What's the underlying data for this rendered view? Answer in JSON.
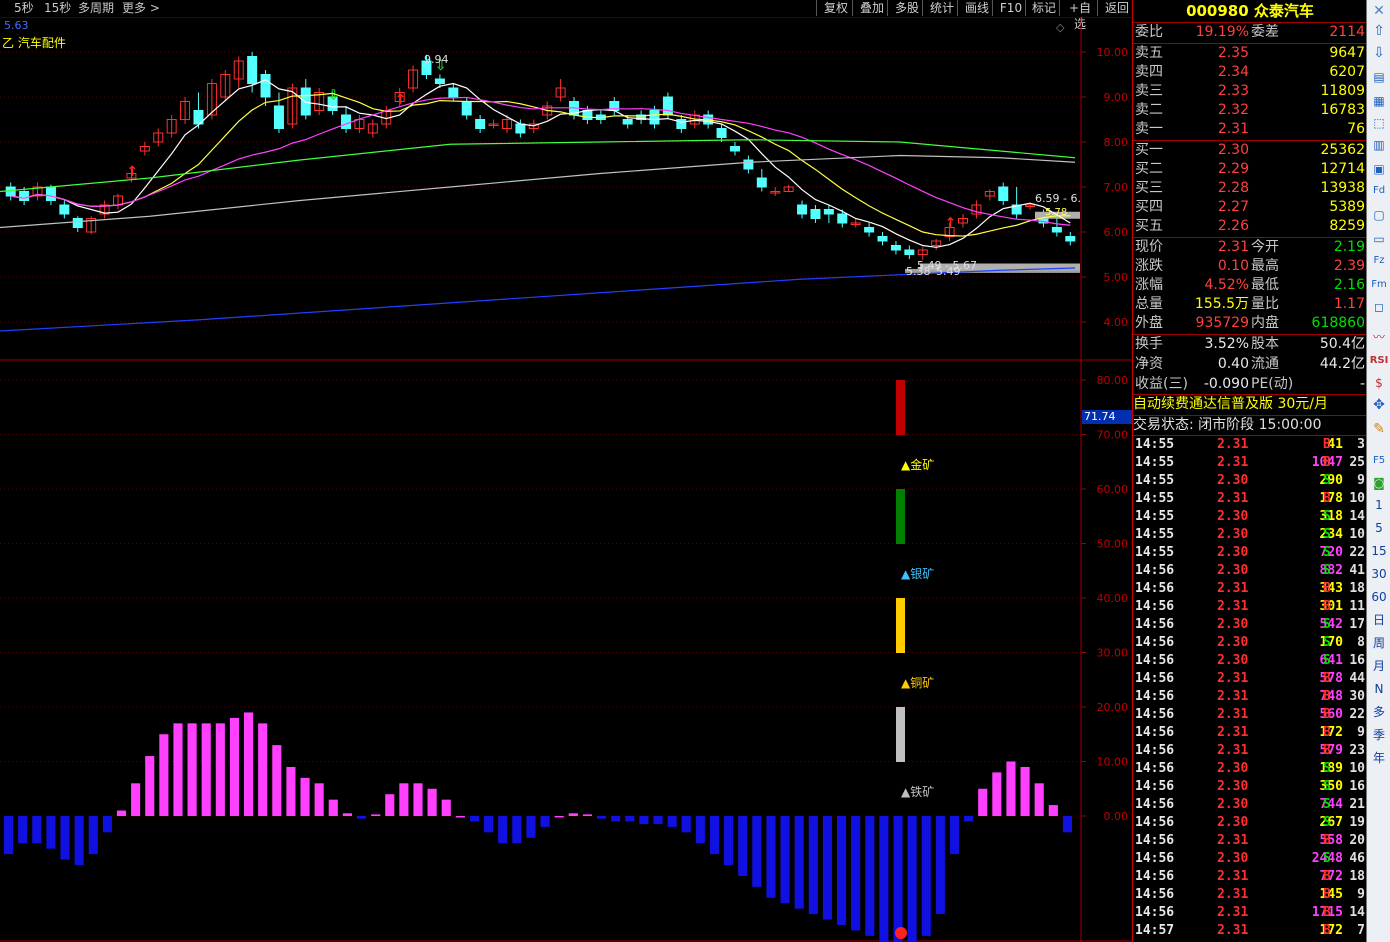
{
  "toolbar": {
    "left": [
      "5秒",
      "15秒",
      "多周期",
      "更多 >"
    ],
    "right": [
      "复权",
      "叠加",
      "多股",
      "统计",
      "画线",
      "F10",
      "标记",
      "+自选",
      "返回"
    ]
  },
  "chart": {
    "top_left_value": "5.63",
    "sector_label": "乙 汽车配件",
    "price_axis": [
      "10.00",
      "9.00",
      "8.00",
      "7.00",
      "6.00",
      "5.00",
      "4.00"
    ],
    "ind_axis": [
      "80.00",
      "70.00",
      "60.00",
      "50.00",
      "40.00",
      "30.00",
      "20.00",
      "10.00",
      "0.00"
    ],
    "current_ind_value": "71.74",
    "annotations": {
      "high": "9.94",
      "mid_right": "6.59 - 6.",
      "low": "5.49 - 5.67",
      "low2": "5.38",
      "low3": "5.49",
      "small": "5.78"
    },
    "mine_labels": [
      "▲金矿",
      "▲银矿",
      "▲铜矿",
      "▲铁矿"
    ],
    "colors": {
      "up": "#ff3030",
      "down": "#54ffff",
      "ma5": "#ffffff",
      "ma10": "#ffff40",
      "ma20": "#ff40ff",
      "ma60": "#40ff40",
      "ma120": "#c0c0c0",
      "ma250": "#2040ff"
    }
  },
  "stock": {
    "code": "000980",
    "name": "众泰汽车"
  },
  "quote": {
    "weibi_label": "委比",
    "weibi": "19.19%",
    "weicha_label": "委差",
    "weicha": "2114",
    "sell": [
      {
        "label": "卖五",
        "price": "2.35",
        "vol": "9647"
      },
      {
        "label": "卖四",
        "price": "2.34",
        "vol": "6207"
      },
      {
        "label": "卖三",
        "price": "2.33",
        "vol": "11809"
      },
      {
        "label": "卖二",
        "price": "2.32",
        "vol": "16783"
      },
      {
        "label": "卖一",
        "price": "2.31",
        "vol": "76"
      }
    ],
    "buy": [
      {
        "label": "买一",
        "price": "2.30",
        "vol": "25362"
      },
      {
        "label": "买二",
        "price": "2.29",
        "vol": "12714"
      },
      {
        "label": "买三",
        "price": "2.28",
        "vol": "13938"
      },
      {
        "label": "买四",
        "price": "2.27",
        "vol": "5389"
      },
      {
        "label": "买五",
        "price": "2.26",
        "vol": "8259"
      }
    ],
    "stats": [
      {
        "l1": "现价",
        "v1": "2.31",
        "c1": "red",
        "l2": "今开",
        "v2": "2.19",
        "c2": "grn"
      },
      {
        "l1": "涨跌",
        "v1": "0.10",
        "c1": "red",
        "l2": "最高",
        "v2": "2.39",
        "c2": "red"
      },
      {
        "l1": "涨幅",
        "v1": "4.52%",
        "c1": "red",
        "l2": "最低",
        "v2": "2.16",
        "c2": "grn"
      },
      {
        "l1": "总量",
        "v1": "155.5万",
        "c1": "yel",
        "l2": "量比",
        "v2": "1.17",
        "c2": "red"
      },
      {
        "l1": "外盘",
        "v1": "935729",
        "c1": "red",
        "l2": "内盘",
        "v2": "618860",
        "c2": "grn"
      }
    ],
    "stats2": [
      {
        "l1": "换手",
        "v1": "3.52%",
        "l2": "股本",
        "v2": "50.4亿"
      },
      {
        "l1": "净资",
        "v1": "0.40",
        "l2": "流通",
        "v2": "44.2亿"
      },
      {
        "l1": "收益(三)",
        "v1": "-0.090",
        "l2": "PE(动)",
        "v2": "-"
      }
    ],
    "promo": "自动续费通达信普及版 30元/月",
    "status": "交易状态: 闭市阶段 15:00:00"
  },
  "ticks": [
    {
      "t": "14:55",
      "p": "2.31",
      "v": "41",
      "d": "B",
      "n": "3"
    },
    {
      "t": "14:55",
      "p": "2.31",
      "v": "1047",
      "d": "B",
      "n": "25"
    },
    {
      "t": "14:55",
      "p": "2.30",
      "v": "290",
      "d": "S",
      "n": "9"
    },
    {
      "t": "14:55",
      "p": "2.31",
      "v": "178",
      "d": "B",
      "n": "10"
    },
    {
      "t": "14:55",
      "p": "2.30",
      "v": "318",
      "d": "S",
      "n": "14"
    },
    {
      "t": "14:55",
      "p": "2.30",
      "v": "234",
      "d": "S",
      "n": "10"
    },
    {
      "t": "14:55",
      "p": "2.30",
      "v": "720",
      "d": "S",
      "n": "22"
    },
    {
      "t": "14:56",
      "p": "2.30",
      "v": "882",
      "d": "S",
      "n": "41"
    },
    {
      "t": "14:56",
      "p": "2.31",
      "v": "343",
      "d": "B",
      "n": "18"
    },
    {
      "t": "14:56",
      "p": "2.31",
      "v": "301",
      "d": "B",
      "n": "11"
    },
    {
      "t": "14:56",
      "p": "2.30",
      "v": "542",
      "d": "S",
      "n": "17"
    },
    {
      "t": "14:56",
      "p": "2.30",
      "v": "170",
      "d": "S",
      "n": "8"
    },
    {
      "t": "14:56",
      "p": "2.30",
      "v": "641",
      "d": "S",
      "n": "16"
    },
    {
      "t": "14:56",
      "p": "2.31",
      "v": "578",
      "d": "B",
      "n": "44"
    },
    {
      "t": "14:56",
      "p": "2.31",
      "v": "748",
      "d": "B",
      "n": "30"
    },
    {
      "t": "14:56",
      "p": "2.31",
      "v": "560",
      "d": "B",
      "n": "22"
    },
    {
      "t": "14:56",
      "p": "2.31",
      "v": "172",
      "d": "B",
      "n": "9"
    },
    {
      "t": "14:56",
      "p": "2.31",
      "v": "579",
      "d": "B",
      "n": "23"
    },
    {
      "t": "14:56",
      "p": "2.30",
      "v": "189",
      "d": "S",
      "n": "10"
    },
    {
      "t": "14:56",
      "p": "2.30",
      "v": "350",
      "d": "S",
      "n": "16"
    },
    {
      "t": "14:56",
      "p": "2.30",
      "v": "744",
      "d": "S",
      "n": "21"
    },
    {
      "t": "14:56",
      "p": "2.30",
      "v": "267",
      "d": "S",
      "n": "19"
    },
    {
      "t": "14:56",
      "p": "2.31",
      "v": "558",
      "d": "B",
      "n": "20"
    },
    {
      "t": "14:56",
      "p": "2.30",
      "v": "2448",
      "d": "S",
      "n": "46"
    },
    {
      "t": "14:56",
      "p": "2.31",
      "v": "772",
      "d": "B",
      "n": "18"
    },
    {
      "t": "14:56",
      "p": "2.31",
      "v": "145",
      "d": "B",
      "n": "9"
    },
    {
      "t": "14:56",
      "p": "2.31",
      "v": "1715",
      "d": "B",
      "n": "14"
    },
    {
      "t": "14:57",
      "p": "2.31",
      "v": "172",
      "d": "B",
      "n": "7"
    }
  ],
  "sidebar": [
    "1",
    "5",
    "15",
    "30",
    "60",
    "日",
    "周",
    "月",
    "N",
    "多",
    "季",
    "年"
  ]
}
